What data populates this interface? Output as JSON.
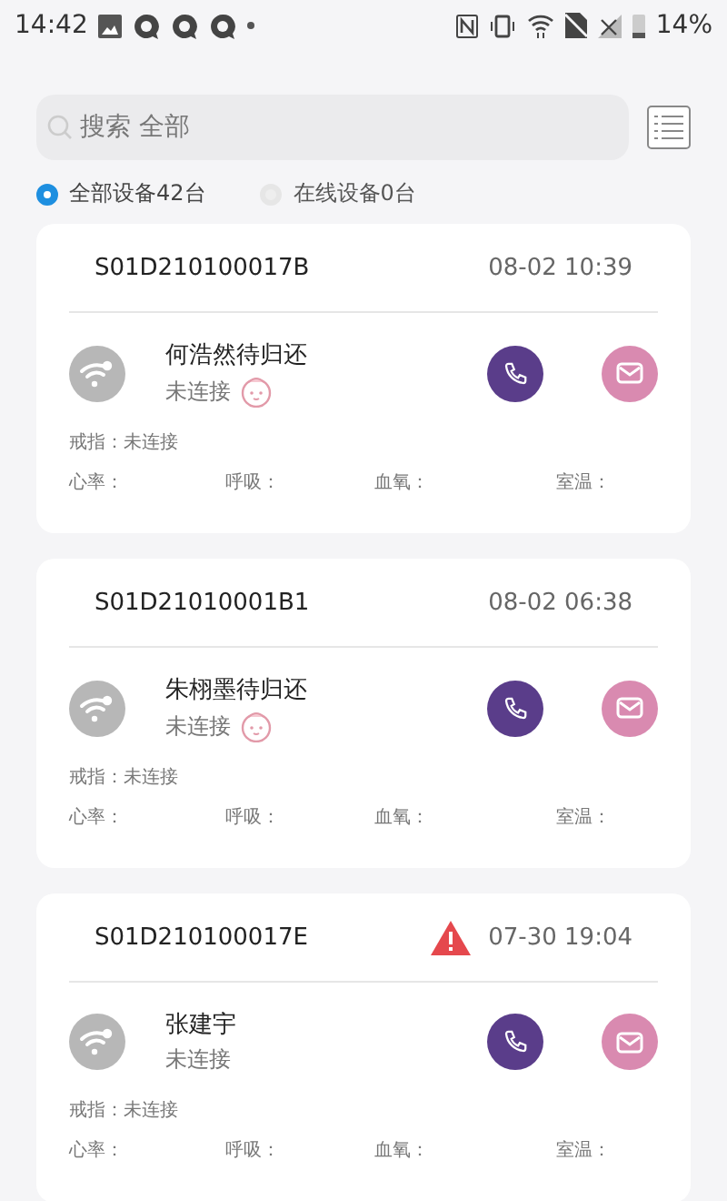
{
  "status_bar": {
    "time": "14:42",
    "battery": "14%"
  },
  "search": {
    "placeholder": "搜索 全部"
  },
  "filters": [
    {
      "label": "全部设备42台",
      "selected": true
    },
    {
      "label": "在线设备0台",
      "selected": false
    }
  ],
  "devices": [
    {
      "serial": "S01D210100017B",
      "time": "08-02 10:39",
      "alert": false,
      "name": "何浩然待归还",
      "status": "未连接",
      "baby_icon": true,
      "ring": "戒指：未连接",
      "metrics": [
        "心率：",
        "呼吸：",
        "血氧：",
        "室温："
      ]
    },
    {
      "serial": "S01D21010001B1",
      "time": "08-02 06:38",
      "alert": false,
      "name": "朱栩墨待归还",
      "status": "未连接",
      "baby_icon": true,
      "ring": "戒指：未连接",
      "metrics": [
        "心率：",
        "呼吸：",
        "血氧：",
        "室温："
      ]
    },
    {
      "serial": "S01D210100017E",
      "time": "07-30 19:04",
      "alert": true,
      "name": "张建宇",
      "status": "未连接",
      "baby_icon": false,
      "ring": "戒指：未连接",
      "metrics": [
        "心率：",
        "呼吸：",
        "血氧：",
        "室温："
      ]
    }
  ]
}
